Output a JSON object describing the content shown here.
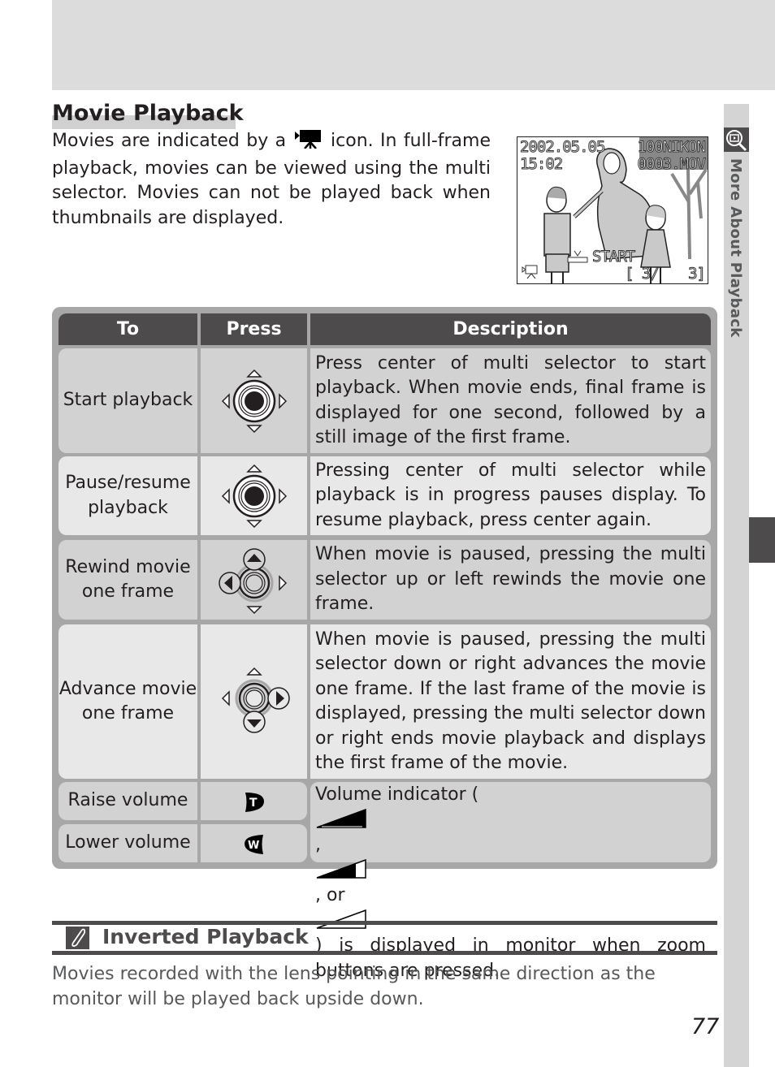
{
  "section_tab": {
    "label": "More About Playback",
    "icon": "playback-magnifier-icon"
  },
  "title": "Movie Playback",
  "intro": {
    "before_icon": "Movies are indicated by a",
    "icon": "movie-camera-icon",
    "after_icon": "icon.  In full-frame playback, movies can be viewed using the multi selector.  Movies can not be played back when thumbnails are displayed."
  },
  "preview": {
    "date": "2002.05.05",
    "time": "15:02",
    "folder": "100NIKON",
    "file": "0003.MOV",
    "start_label": "START",
    "frame_counter_left": "[  3/",
    "frame_counter_right": "3]",
    "mode_icon": "movie-camera-icon"
  },
  "table": {
    "headers": {
      "to": "To",
      "press": "Press",
      "description": "Description"
    },
    "rows": [
      {
        "to": "Start playback",
        "press_icon": "multi-selector-center-icon",
        "description": "Press center of multi selector to start playback. When movie ends, final frame is displayed for one second, followed by a still image of the first frame."
      },
      {
        "to": "Pause/resume playback",
        "press_icon": "multi-selector-center-icon",
        "description": "Pressing center of multi selector while playback is in progress pauses display.  To resume playback, press center again."
      },
      {
        "to": "Rewind movie one frame",
        "press_icon": "multi-selector-up-left-icon",
        "description": "When movie is paused, pressing the multi selector up or left rewinds the movie one frame."
      },
      {
        "to": "Advance movie one frame",
        "press_icon": "multi-selector-down-right-icon",
        "description": "When movie is paused, pressing the multi selector down or right advances the movie one frame.  If the last frame of the movie is displayed, pressing the multi selector down or right ends movie playback and displays the first frame of the movie."
      },
      {
        "to": "Raise volume",
        "press_icon": "zoom-t-button-icon",
        "glyph": "T"
      },
      {
        "to": "Lower volume",
        "press_icon": "zoom-w-button-icon",
        "glyph": "W"
      }
    ],
    "volume_description": {
      "before": "Volume indicator (",
      "sep1": ",",
      "sep2": ", or",
      "after": ") is displayed in monitor when zoom buttons are pressed.",
      "levels": [
        1.0,
        0.6,
        0.0
      ]
    }
  },
  "note": {
    "icon": "pencil-note-icon",
    "title": "Inverted Playback",
    "body": "Movies recorded with the lens pointing in the same direction as the monitor will be played back upside down."
  },
  "page_number": "77"
}
